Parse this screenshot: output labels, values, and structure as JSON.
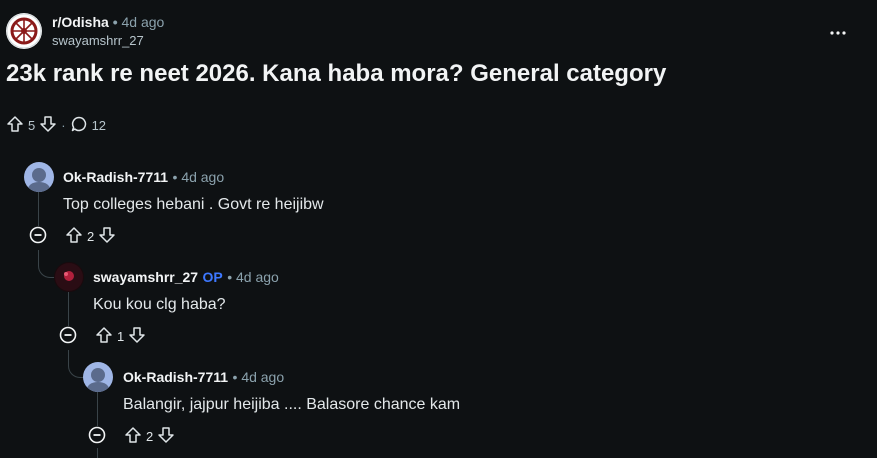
{
  "post": {
    "subreddit": "r/Odisha",
    "age": "4d ago",
    "author": "swayamshrr_27",
    "title": "23k rank re neet 2026. Kana haba mora? General category",
    "score": "5",
    "comment_count": "12"
  },
  "comments": [
    {
      "author": "Ok-Radish-7711",
      "op": "",
      "age": "4d ago",
      "body": "Top colleges hebani . Govt re heijibw",
      "score": "2"
    },
    {
      "author": "swayamshrr_27",
      "op": "OP",
      "age": "4d ago",
      "body": "Kou kou clg haba?",
      "score": "1"
    },
    {
      "author": "Ok-Radish-7711",
      "op": "",
      "age": "4d ago",
      "body": "Balangir, jajpur heijiba .... Balasore chance kam",
      "score": "2"
    }
  ],
  "colors": {
    "background": "#0e1113",
    "op_badge": "#3d78ff",
    "meta": "#8ba2ad"
  },
  "icons": [
    "subreddit-avatar",
    "more-options-icon",
    "upvote-icon",
    "downvote-icon",
    "comment-icon",
    "collapse-icon",
    "user-avatar"
  ]
}
